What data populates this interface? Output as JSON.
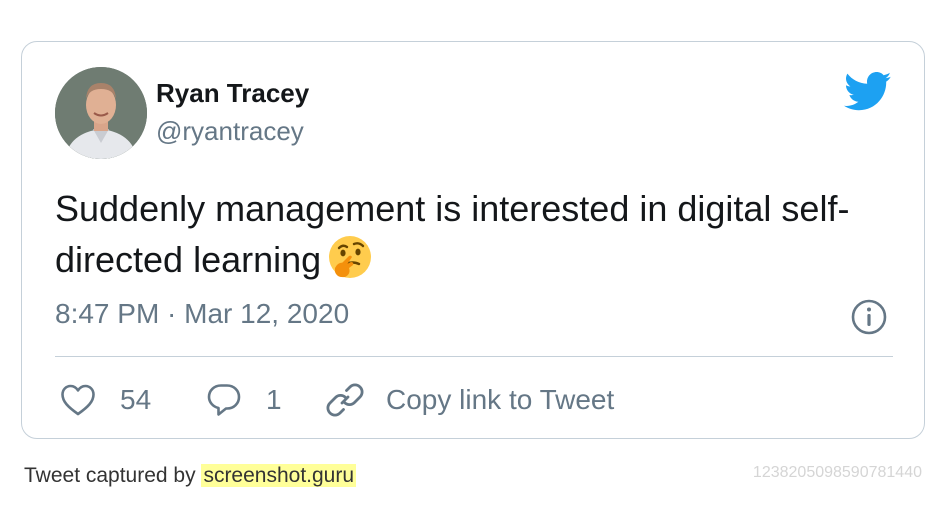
{
  "author": {
    "name": "Ryan Tracey",
    "handle": "@ryantracey"
  },
  "tweet": {
    "text": "Suddenly management is interested in digital self-directed learning",
    "emoji": "thinking-face",
    "timestamp": "8:47 PM · Mar 12, 2020"
  },
  "actions": {
    "likes": "54",
    "replies": "1",
    "copy_link_label": "Copy link to Tweet"
  },
  "footer": {
    "caption_prefix": "Tweet captured by ",
    "caption_brand": "screenshot.guru",
    "tweet_id": "1238205098590781440"
  },
  "colors": {
    "text_primary": "#14171a",
    "text_secondary": "#657786",
    "twitter_blue": "#1da1f2",
    "border": "#c5d0d9",
    "brand_highlight": "#ffff99"
  },
  "icons": [
    "twitter-bird-icon",
    "info-icon",
    "heart-icon",
    "reply-bubble-icon",
    "link-icon"
  ]
}
